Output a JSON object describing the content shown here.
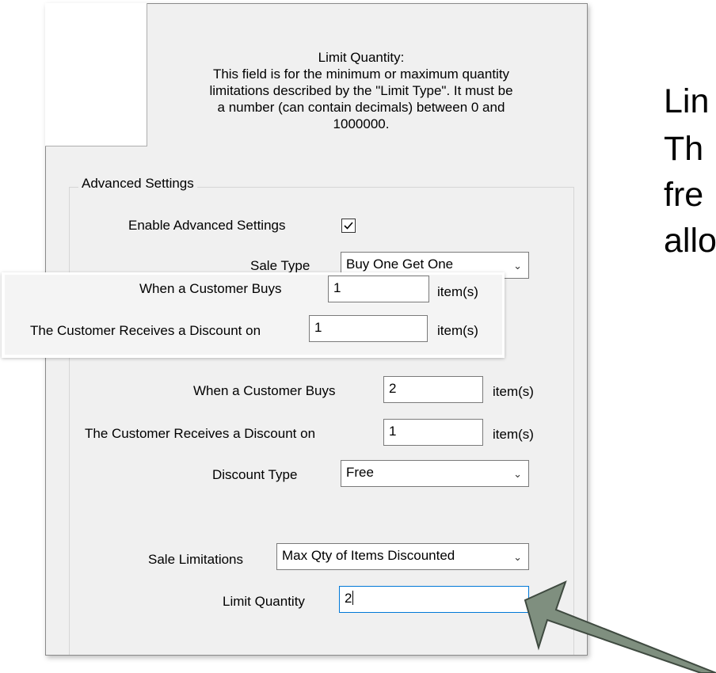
{
  "help": {
    "lines": [
      "Limit Quantity:",
      "This field is for the minimum or maximum quantity",
      "limitations described by the \"Limit Type\". It must be",
      "a number (can contain decimals) between 0 and",
      "1000000."
    ]
  },
  "advanced": {
    "group_label": "Advanced Settings",
    "enable_label": "Enable Advanced Settings",
    "enable_checked": true,
    "sale_type_label": "Sale Type",
    "sale_type_value": "Buy One Get One",
    "buys_label": "When a Customer Buys",
    "buys_value": "2",
    "receives_label": "The Customer Receives a Discount on",
    "receives_value": "1",
    "items_unit": "item(s)",
    "discount_type_label": "Discount Type",
    "discount_type_value": "Free",
    "sale_limitations_label": "Sale Limitations",
    "sale_limitations_value": "Max Qty of Items Discounted",
    "limit_quantity_label": "Limit Quantity",
    "limit_quantity_value": "2"
  },
  "overlay": {
    "buys_label": "When a Customer Buys",
    "buys_value": "1",
    "receives_label": "The Customer Receives a Discount on",
    "receives_value": "1",
    "items_unit": "item(s)"
  },
  "side_text": {
    "line1": "Lin",
    "line2": "Th",
    "line3": "fre",
    "line4": "allo"
  },
  "colors": {
    "arrow_fill": "#7f8f7f",
    "arrow_stroke": "#3f4a40",
    "focus_border": "#0078d7"
  }
}
